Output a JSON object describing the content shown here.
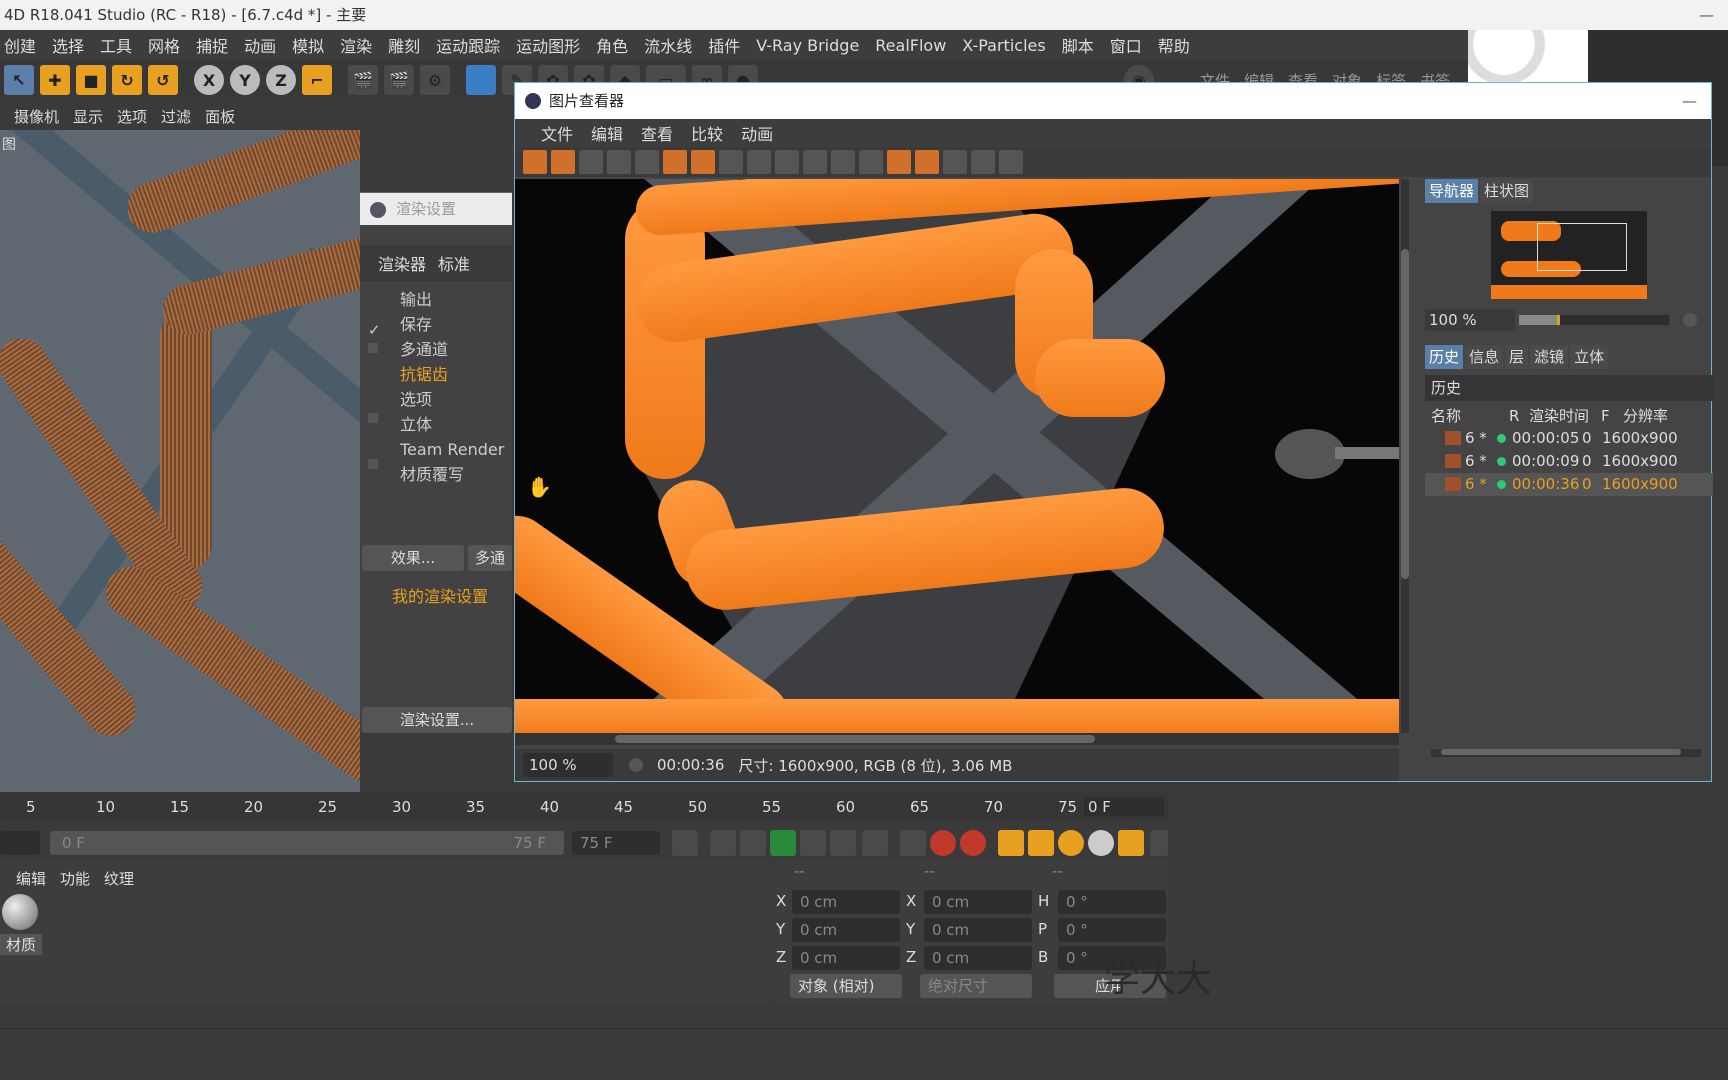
{
  "window": {
    "title": "4D R18.041 Studio (RC - R18) - [6.7.c4d *] - 主要",
    "minimize": "—"
  },
  "menubar": [
    "创建",
    "选择",
    "工具",
    "网格",
    "捕捉",
    "动画",
    "模拟",
    "渲染",
    "雕刻",
    "运动跟踪",
    "运动图形",
    "角色",
    "流水线",
    "插件",
    "V-Ray Bridge",
    "RealFlow",
    "X-Particles",
    "脚本",
    "窗口",
    "帮助"
  ],
  "toolbar": {
    "x": "X",
    "y": "Y",
    "z": "Z",
    "right_menu": [
      "文件",
      "编辑",
      "查看",
      "对象",
      "标签",
      "书签"
    ]
  },
  "viewport_menu": [
    "摄像机",
    "显示",
    "选项",
    "过滤",
    "面板"
  ],
  "viewport_label": "图",
  "render_settings": {
    "title": "渲染设置",
    "tabs": [
      "渲染器",
      "标准"
    ],
    "items": [
      "输出",
      "保存",
      "多通道",
      "抗锯齿",
      "选项",
      "立体",
      "Team Render",
      "材质覆写"
    ],
    "active_item": "抗锯齿",
    "effects_button": "效果...",
    "multipass_button": "多通",
    "preset": "我的渲染设置",
    "render_settings_button": "渲染设置..."
  },
  "viewer": {
    "title": "图片查看器",
    "menu": [
      "文件",
      "编辑",
      "查看",
      "比较",
      "动画"
    ],
    "zoom": "100 %",
    "time": "00:00:36",
    "info": "尺寸: 1600x900, RGB (8 位), 3.06 MB",
    "nav_tabs": [
      "导航器",
      "柱状图"
    ],
    "nav_zoom": "100 %",
    "info_tabs": [
      "历史",
      "信息",
      "层",
      "滤镜",
      "立体"
    ],
    "history_header": "历史",
    "columns": [
      "名称",
      "R",
      "渲染时间",
      "F",
      "分辨率"
    ],
    "rows": [
      {
        "name": "6 *",
        "time": "00:00:05",
        "f": "0",
        "res": "1600x900"
      },
      {
        "name": "6 *",
        "time": "00:00:09",
        "f": "0",
        "res": "1600x900"
      },
      {
        "name": "6 *",
        "time": "00:00:36",
        "f": "0",
        "res": "1600x900"
      }
    ],
    "selected_row": 2
  },
  "timeline": {
    "ticks": [
      "5",
      "10",
      "15",
      "20",
      "25",
      "30",
      "35",
      "40",
      "45",
      "50",
      "55",
      "60",
      "65",
      "70",
      "75"
    ],
    "current_frame": "0 F",
    "start": "0 F",
    "end_inner": "75 F",
    "end": "75 F"
  },
  "materials": {
    "menu": [
      "编辑",
      "功能",
      "纹理"
    ],
    "material_label": "材质"
  },
  "coords": {
    "headers": [
      "--",
      "--",
      "--"
    ],
    "rows": [
      {
        "a": "X",
        "av": "0 cm",
        "b": "X",
        "bv": "0 cm",
        "c": "H",
        "cv": "0 °"
      },
      {
        "a": "Y",
        "av": "0 cm",
        "b": "Y",
        "bv": "0 cm",
        "c": "P",
        "cv": "0 °"
      },
      {
        "a": "Z",
        "av": "0 cm",
        "b": "Z",
        "bv": "0 cm",
        "c": "B",
        "cv": "0 °"
      }
    ],
    "mode": "对象 (相对)",
    "size_mode": "绝对尺寸",
    "apply": "应用"
  },
  "watermark": "学大大"
}
